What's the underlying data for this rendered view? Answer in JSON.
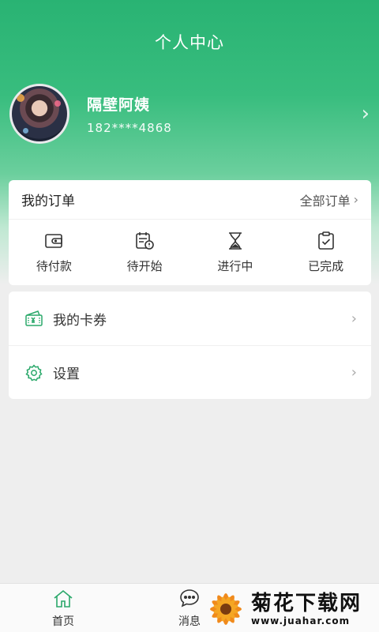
{
  "header": {
    "title": "个人中心"
  },
  "profile": {
    "name": "隔壁阿姨",
    "phone": "182****4868"
  },
  "orders": {
    "title": "我的订单",
    "all_label": "全部订单",
    "items": [
      {
        "label": "待付款",
        "icon": "wallet-icon"
      },
      {
        "label": "待开始",
        "icon": "pending-calendar-icon"
      },
      {
        "label": "进行中",
        "icon": "hourglass-icon"
      },
      {
        "label": "已完成",
        "icon": "clipboard-check-icon"
      }
    ]
  },
  "menu": {
    "items": [
      {
        "label": "我的卡券",
        "icon": "coupon-icon"
      },
      {
        "label": "设置",
        "icon": "settings-gear-icon"
      }
    ]
  },
  "tabbar": {
    "items": [
      {
        "label": "首页",
        "icon": "home-icon"
      },
      {
        "label": "消息",
        "icon": "chat-bubble-icon"
      }
    ]
  },
  "watermark": {
    "title": "菊花下载网",
    "url": "www.juahar.com"
  },
  "colors": {
    "brand": "#29b373",
    "background": "#eeeeee"
  }
}
